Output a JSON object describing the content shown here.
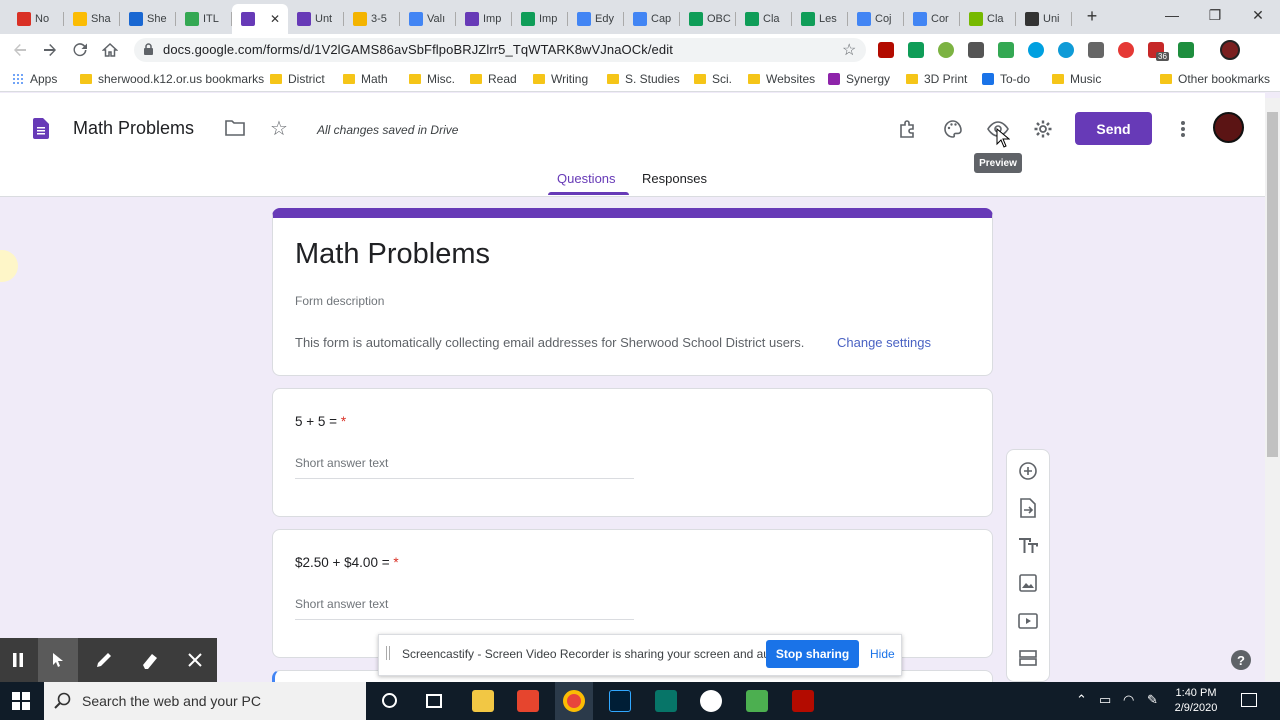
{
  "browser": {
    "tabs": [
      {
        "label": "No",
        "color": "#d93025"
      },
      {
        "label": "Sha",
        "color": "#fbbc04"
      },
      {
        "label": "She",
        "color": "#1967d2"
      },
      {
        "label": "ITL",
        "color": "#34a853"
      },
      {
        "label": "",
        "color": "#673ab7",
        "active": true
      },
      {
        "label": "Unt",
        "color": "#673ab7"
      },
      {
        "label": "3-5",
        "color": "#f4b400"
      },
      {
        "label": "Valı",
        "color": "#4285f4"
      },
      {
        "label": "Imp",
        "color": "#673ab7"
      },
      {
        "label": "Imp",
        "color": "#0f9d58"
      },
      {
        "label": "Edy",
        "color": "#4285f4"
      },
      {
        "label": "Cap",
        "color": "#4285f4"
      },
      {
        "label": "OBC",
        "color": "#0f9d58"
      },
      {
        "label": "Cla",
        "color": "#0f9d58"
      },
      {
        "label": "Les",
        "color": "#0f9d58"
      },
      {
        "label": "Coj",
        "color": "#4285f4"
      },
      {
        "label": "Cor",
        "color": "#4285f4"
      },
      {
        "label": "Cla",
        "color": "#76b900"
      },
      {
        "label": "Uni",
        "color": "#333333"
      }
    ],
    "new_tab": "+",
    "window_controls": {
      "minimize": "—",
      "restore": "❐",
      "close": "✕"
    },
    "url": "docs.google.com/forms/d/1V2lGAMS86avSbFflpoBRJZlrr5_TqWTARK8wVJnaOCk/edit",
    "extension_badge": "36",
    "bookmarks": [
      {
        "label": "Apps",
        "type": "apps"
      },
      {
        "label": "sherwood.k12.or.us bookmarks",
        "type": "folder"
      },
      {
        "label": "District",
        "type": "folder"
      },
      {
        "label": "Math",
        "type": "folder"
      },
      {
        "label": "Misc.",
        "type": "folder"
      },
      {
        "label": "Read",
        "type": "folder"
      },
      {
        "label": "Writing",
        "type": "folder"
      },
      {
        "label": "S. Studies",
        "type": "folder"
      },
      {
        "label": "Sci.",
        "type": "folder"
      },
      {
        "label": "Websites",
        "type": "folder"
      },
      {
        "label": "Synergy",
        "type": "site"
      },
      {
        "label": "3D Print",
        "type": "folder"
      },
      {
        "label": "To-do",
        "type": "site"
      },
      {
        "label": "Music",
        "type": "folder"
      },
      {
        "label": "Other bookmarks",
        "type": "folder"
      }
    ]
  },
  "forms": {
    "doc_title": "Math Problems",
    "saved_status": "All changes saved in Drive",
    "send_label": "Send",
    "tooltip": "Preview",
    "tabs": {
      "questions": "Questions",
      "responses": "Responses"
    },
    "accent": "#673ab7",
    "form_title": "Math Problems",
    "form_description": "Form description",
    "email_notice": "This form is automatically collecting email addresses for Sherwood School District users.",
    "change_settings": "Change settings",
    "questions": [
      {
        "text": "5 + 5 =",
        "required": "*",
        "placeholder": "Short answer text"
      },
      {
        "text": "$2.50 + $4.00 =",
        "required": "*",
        "placeholder": "Short answer text"
      }
    ],
    "help": "?"
  },
  "screencastify": {
    "message": "Screencastify - Screen Video Recorder is sharing your screen and audio.",
    "stop_label": "Stop sharing",
    "hide_label": "Hide"
  },
  "taskbar": {
    "search_placeholder": "Search the web and your PC",
    "time": "1:40 PM",
    "date": "2/9/2020"
  }
}
